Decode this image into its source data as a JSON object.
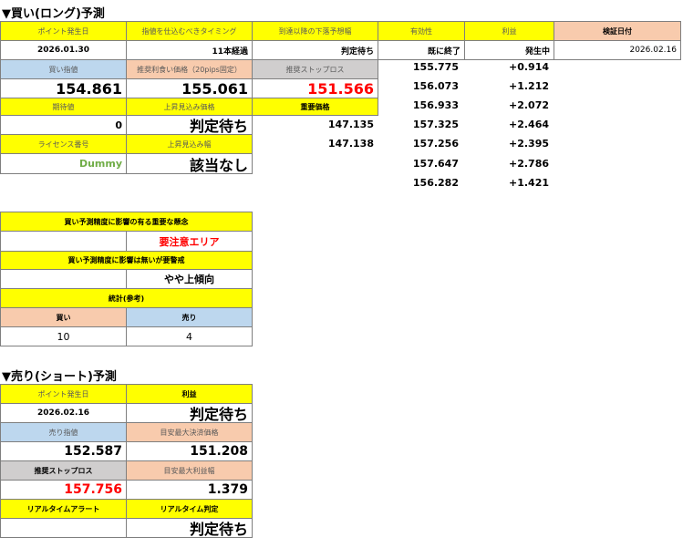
{
  "long": {
    "title": "▼買い(ロング)予測",
    "h_point_date": "ポイント発生日",
    "h_timing": "指値を仕込むべきタイミング",
    "h_downside": "到達以降の下落予想幅",
    "h_valid": "有効性",
    "h_profit": "利益",
    "h_verify": "検証日付",
    "point_date": "2026.01.30",
    "timing": "11本経過",
    "downside": "判定待ち",
    "valid": "既に終了",
    "profit_status": "発生中",
    "verify_date": "2026.02.16",
    "h_buy_limit": "買い指値",
    "h_take_profit": "推奨利食い価格（20pips固定）",
    "h_stop_loss": "推奨ストップロス",
    "buy_limit": "154.861",
    "take_profit": "155.061",
    "stop_loss": "151.566",
    "h_expected": "期待値",
    "h_upside_price": "上昇見込み価格",
    "h_important": "重要価格",
    "expected": "0",
    "upside_price": "判定待ち",
    "h_license": "ライセンス番号",
    "h_upside_width": "上昇見込み幅",
    "license": "Dummy",
    "upside_width": "該当なし",
    "important_prices": [
      "147.135",
      "147.138"
    ],
    "price_list": [
      {
        "price": "155.775",
        "gain": "+0.914"
      },
      {
        "price": "156.073",
        "gain": "+1.212"
      },
      {
        "price": "156.933",
        "gain": "+2.072"
      },
      {
        "price": "157.325",
        "gain": "+2.464"
      },
      {
        "price": "157.256",
        "gain": "+2.395"
      },
      {
        "price": "157.647",
        "gain": "+2.786"
      },
      {
        "price": "156.282",
        "gain": "+1.421"
      }
    ]
  },
  "factors": {
    "h_negative": "買い予測精度に影響の有る重要な懸念",
    "negative": "要注意エリア",
    "h_other": "買い予測精度に影響は無いが要警戒",
    "other": "やや上傾向",
    "h_stats": "統計(参考)",
    "h_buy": "買い",
    "h_sell": "売り",
    "buy_count": "10",
    "sell_count": "4"
  },
  "short": {
    "title": "▼売り(ショート)予測",
    "h_point_date": "ポイント発生日",
    "h_profit": "利益",
    "point_date": "2026.02.16",
    "profit": "判定待ち",
    "h_sell_limit": "売り指値",
    "h_target_exit": "目安最大決済価格",
    "sell_limit": "152.587",
    "target_exit": "151.208",
    "h_stop_loss": "推奨ストップロス",
    "h_target_profit": "目安最大利益幅",
    "stop_loss": "157.756",
    "target_profit": "1.379",
    "h_rt_alert": "リアルタイムアラート",
    "h_rt_judge": "リアルタイム判定",
    "rt_alert": "",
    "rt_judge": "判定待ち"
  }
}
